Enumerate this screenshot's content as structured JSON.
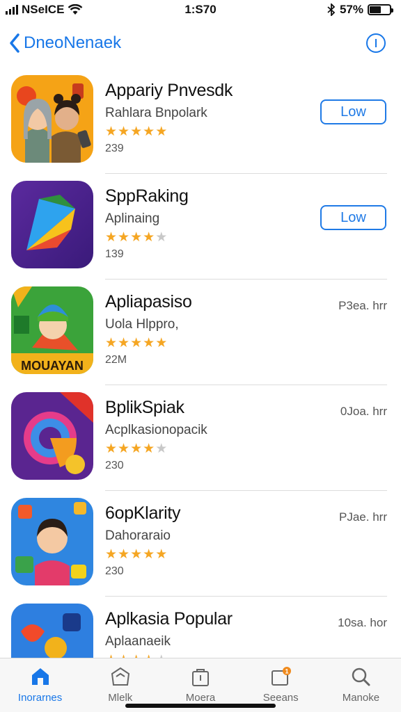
{
  "status_bar": {
    "carrier": "NSeICE",
    "time": "1:S70",
    "battery": "57%",
    "battery_level": 0.57
  },
  "nav": {
    "back_label": "DneoNenaek",
    "back_icon": "chevron-left-icon",
    "info_icon": "info-icon"
  },
  "colors": {
    "accent": "#1877e8",
    "star": "#f5a623",
    "star_off": "#c8c8c8"
  },
  "apps": [
    {
      "name": "Appariy Pnvesdk",
      "subtitle": "Rahlara Bnpolark",
      "rating": 5,
      "count": "239",
      "action": "Low",
      "price": ""
    },
    {
      "name": "SppRaking",
      "subtitle": "Aplinaing",
      "rating": 4,
      "count": "139",
      "action": "Low",
      "price": ""
    },
    {
      "name": "Apliapasiso",
      "subtitle": "Uola Hlppro,",
      "rating": 4.5,
      "count": "22M",
      "action": "",
      "price": "P3ea. hrr"
    },
    {
      "name": "BplikSpiak",
      "subtitle": "Acplkasionopacik",
      "rating": 4,
      "count": "230",
      "action": "",
      "price": "0Joa. hrr"
    },
    {
      "name": "6opKlarity",
      "subtitle": "Dahoraraio",
      "rating": 4.5,
      "count": "230",
      "action": "",
      "price": "PJae. hrr"
    },
    {
      "name": "Aplkasia Popular",
      "subtitle": "Aplaanaeik",
      "rating": 4,
      "count": "",
      "action": "",
      "price": "10sa. hor"
    }
  ],
  "tabs": [
    {
      "label": "Inorarnes",
      "icon": "home-icon",
      "active": true
    },
    {
      "label": "Mlelk",
      "icon": "store-icon",
      "active": false
    },
    {
      "label": "Moera",
      "icon": "bag-icon",
      "active": false
    },
    {
      "label": "Seeans",
      "icon": "updates-icon",
      "active": false
    },
    {
      "label": "Manoke",
      "icon": "search-icon",
      "active": false
    }
  ]
}
